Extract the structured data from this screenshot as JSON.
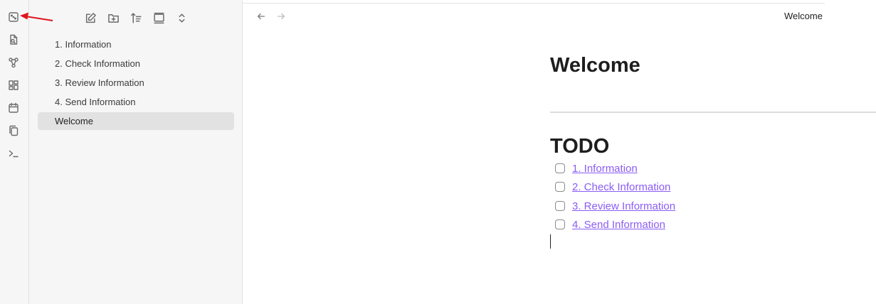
{
  "ribbon": {
    "icons": [
      {
        "name": "quick-switcher-icon"
      },
      {
        "name": "search-file-icon"
      },
      {
        "name": "graph-view-icon"
      },
      {
        "name": "canvas-icon"
      },
      {
        "name": "daily-note-calendar-icon"
      },
      {
        "name": "templates-copy-icon"
      },
      {
        "name": "terminal-icon"
      }
    ]
  },
  "explorer": {
    "toolbar": [
      {
        "name": "new-note-icon"
      },
      {
        "name": "new-folder-icon"
      },
      {
        "name": "sort-order-icon"
      },
      {
        "name": "auto-reveal-icon"
      },
      {
        "name": "collapse-all-icon"
      }
    ],
    "files": [
      {
        "label": "1. Information"
      },
      {
        "label": "2. Check Information"
      },
      {
        "label": "3. Review Information"
      },
      {
        "label": "4. Send Information"
      },
      {
        "label": "Welcome",
        "active": true
      }
    ]
  },
  "tab": {
    "title": "Welcome"
  },
  "document": {
    "title": "Welcome",
    "heading": "TODO",
    "tasks": [
      {
        "text": "1. Information",
        "checked": false
      },
      {
        "text": "2. Check Information",
        "checked": false
      },
      {
        "text": "3. Review Information",
        "checked": false
      },
      {
        "text": "4. Send Information",
        "checked": false
      }
    ]
  },
  "colors": {
    "link": "#8a5cf5",
    "annotation_arrow": "#e0141e",
    "sidebar_bg": "#f6f6f6",
    "active_file_bg": "#e2e2e2"
  }
}
